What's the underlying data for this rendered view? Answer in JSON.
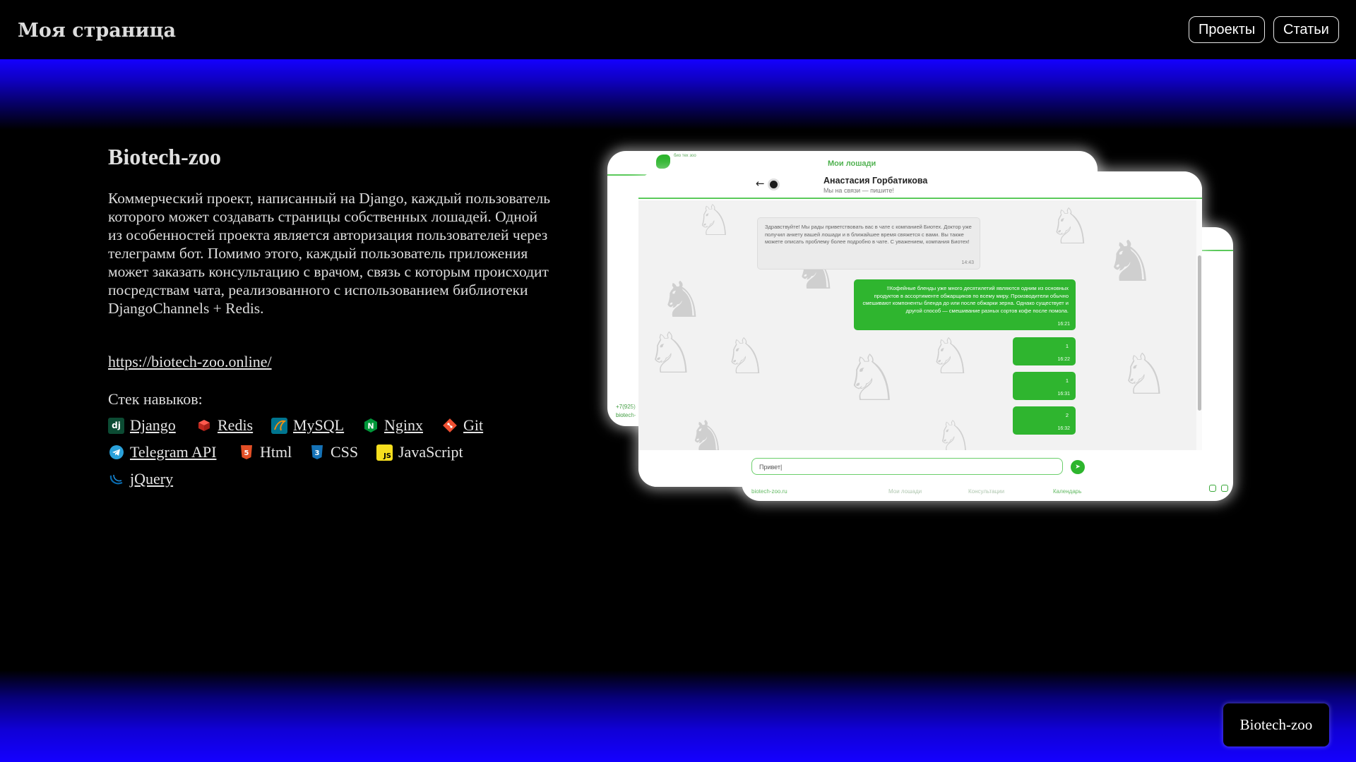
{
  "header": {
    "brand": "Моя страница",
    "nav": {
      "projects": "Проекты",
      "articles": "Статьи"
    }
  },
  "project": {
    "title": "Biotech-zoo",
    "description": "Коммерческий проект, написанный на Django, каждый пользователь которого может создавать страницы собственных лошадей. Одной из особенностей проекта является авторизация пользователей через телеграмм бот. Помимо этого, каждый пользователь приложения может заказать консультацию с врачом, связь с которым происходит посредствам чата, реализованного с использованием библиотеки DjangoChannels + Redis.",
    "link": "https://biotech-zoo.online/",
    "stack_label": "Стек навыков:",
    "skills": [
      {
        "label": "Django",
        "icon": "django-icon",
        "color": "#0c4b33",
        "underlined": true
      },
      {
        "label": "Redis",
        "icon": "redis-icon",
        "color": "#dc382d",
        "underlined": true
      },
      {
        "label": "MySQL",
        "icon": "mysql-icon",
        "color": "#00758f",
        "underlined": true
      },
      {
        "label": "Nginx",
        "icon": "nginx-icon",
        "color": "#009639",
        "underlined": true
      },
      {
        "label": "Git",
        "icon": "git-icon",
        "color": "#f05032",
        "underlined": true
      },
      {
        "label": "Telegram API",
        "icon": "telegram-icon",
        "color": "#2aa1da",
        "underlined": true
      },
      {
        "label": "Html",
        "icon": "html5-icon",
        "color": "#e34f26",
        "underlined": false
      },
      {
        "label": "CSS",
        "icon": "css3-icon",
        "color": "#1572b6",
        "underlined": false
      },
      {
        "label": "JavaScript",
        "icon": "javascript-icon",
        "color": "#f7df1e",
        "underlined": false
      },
      {
        "label": "jQuery",
        "icon": "jquery-icon",
        "color": "#0769ad",
        "underlined": true
      }
    ]
  },
  "preview": {
    "back1": {
      "logo_text": "био тех зоо",
      "title": "Мои лошади",
      "phone": "+7(925)",
      "site": "biotech-"
    },
    "back2": {
      "footer": [
        "biotech-zoo.ru",
        "Мои лошади",
        "Консультации",
        "Календарь"
      ]
    },
    "chat": {
      "name": "Анастасия Горбатикова",
      "status": "Мы на связи — пишите!",
      "messages": [
        {
          "dir": "in",
          "text": "Здравствуйте! Мы рады приветствовать вас в чате с компанией Биотех. Доктор уже получил анкету вашей лошади и в ближайшее время свяжется с вами. Вы также можете описать проблему более подробно в чате. С уважением, компания Биотех!",
          "time": "14:43"
        },
        {
          "dir": "out",
          "text": "!!Кофейные бленды уже много десятилетий являются одним из основных продуктов в ассортименте обжарщиков по всему миру. Производители обычно смешивают компоненты бленда до или после обжарки зерна. Однако существует и другой способ — смешивание разных сортов кофе после помола.",
          "time": "16:21"
        },
        {
          "dir": "out",
          "text": "1",
          "time": "16:22"
        },
        {
          "dir": "out",
          "text": "1",
          "time": "16:31"
        },
        {
          "dir": "out",
          "text": "2",
          "time": "16:32"
        }
      ],
      "input_value": "Привет|"
    }
  },
  "badge": "Biotech-zoo",
  "colors": {
    "accent_blue": "#1400ff",
    "chat_green": "#2fb52f"
  }
}
